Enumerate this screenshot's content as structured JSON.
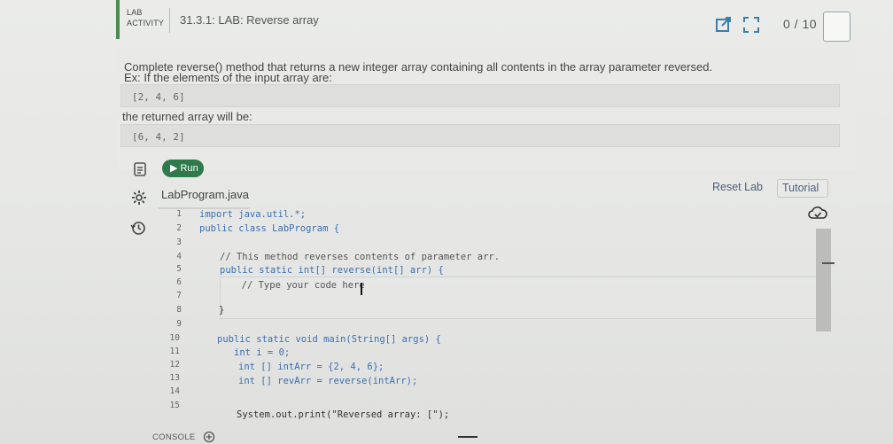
{
  "header": {
    "tag_line1": "LAB",
    "tag_line2": "ACTIVITY",
    "title": "31.3.1: LAB: Reverse array",
    "score": "0 / 10",
    "icons": [
      "external-link-icon",
      "fullscreen-icon"
    ]
  },
  "description": {
    "line1": "Complete reverse() method that returns a new integer array containing all contents in the array parameter reversed.",
    "line2": "Ex: If the elements of the input array are:",
    "sample_input": "[2,  4,  6]",
    "line3": "the returned array will be:",
    "sample_output": "[6,  4,  2]"
  },
  "toolbar": {
    "run_label": "Run",
    "file_name": "LabProgram.java",
    "reset_label": "Reset Lab",
    "tutorial_label": "Tutorial",
    "icons": [
      "notes-icon",
      "settings-icon",
      "history-icon",
      "cloud-sync-icon"
    ]
  },
  "editor": {
    "line_numbers": [
      "1",
      "2",
      "3",
      "4",
      "5",
      "6",
      "7",
      "8",
      "9",
      "10",
      "11",
      "12",
      "13",
      "14",
      "15"
    ],
    "lines": [
      "import java.util.*;",
      "public class LabProgram {",
      "",
      "// This method reverses contents of parameter arr.",
      "public static int[] reverse(int[] arr) {",
      "  // Type your code here",
      "",
      "}",
      "",
      "public static void main(String[] args) {",
      "int i = 0;",
      "int [] intArr = {2, 4, 6};",
      "int [] revArr = reverse(intArr);",
      "",
      "System.out.print(\"Reversed array: [\");"
    ]
  },
  "console": {
    "label": "CONSOLE"
  },
  "colors": {
    "accent_green": "#2e7a4b",
    "keyword_blue": "#3b6fb0"
  }
}
